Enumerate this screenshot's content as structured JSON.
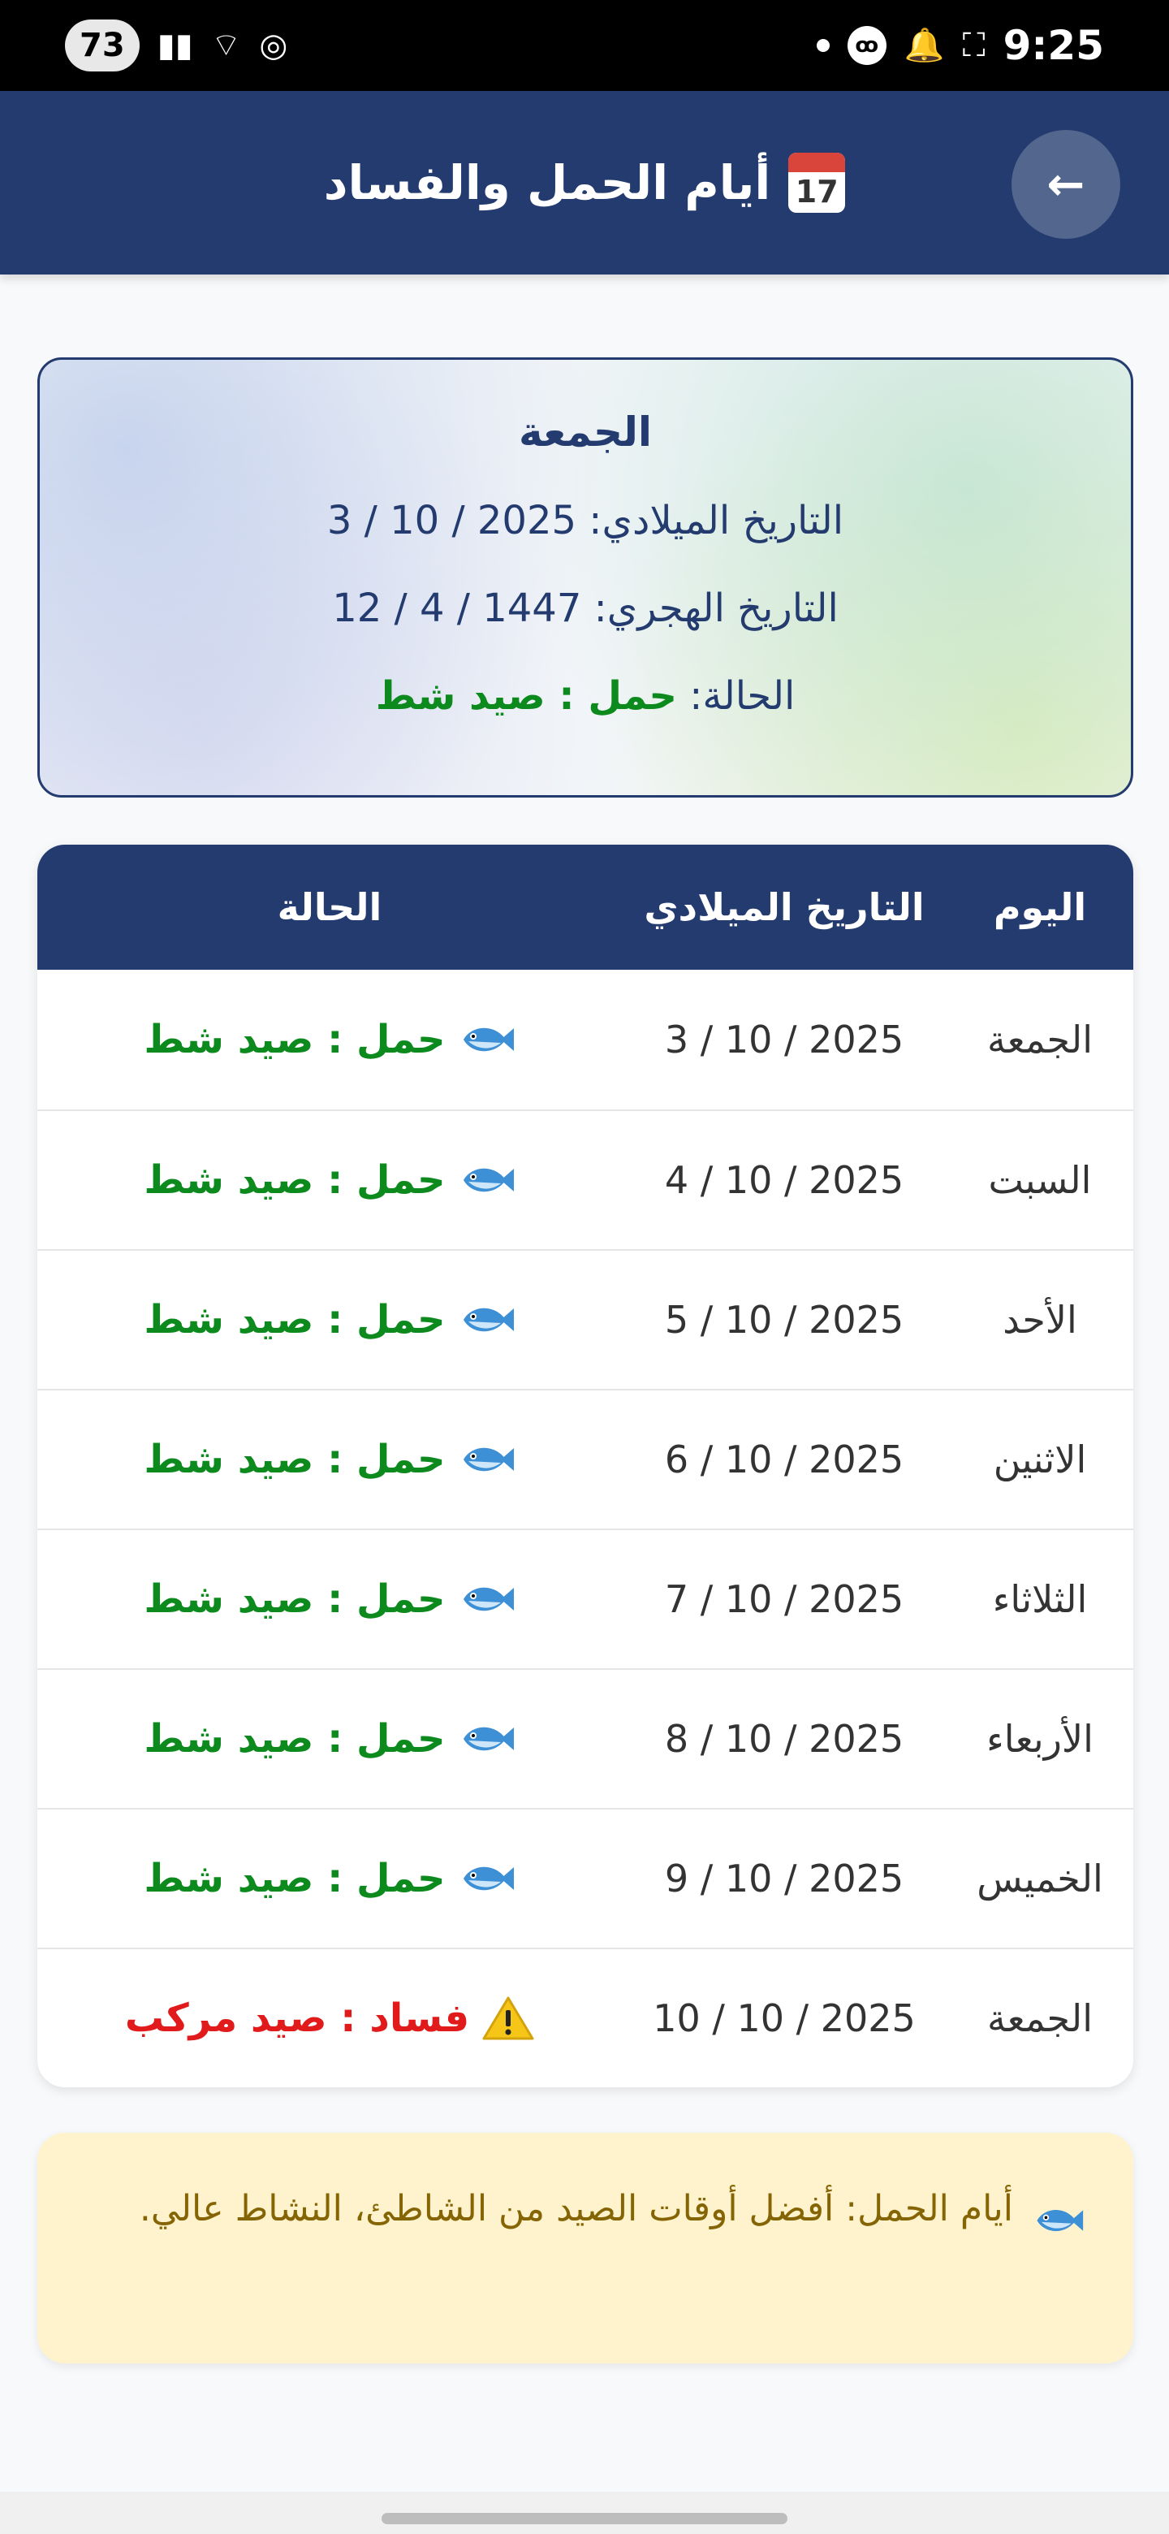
{
  "status_bar": {
    "battery": "73",
    "time": "9:25"
  },
  "app_bar": {
    "title": "أيام الحمل والفساد",
    "calendar_icon_day": "17",
    "back_arrow": "←"
  },
  "today": {
    "day": "الجمعة",
    "gregorian_label": "التاريخ الميلادي:",
    "gregorian_value": "3 / 10 / 2025",
    "hijri_label": "التاريخ الهجري:",
    "hijri_value": "12 / 4 / 1447",
    "status_label": "الحالة:",
    "status_value": "حمل : صيد شط"
  },
  "table": {
    "headers": {
      "day": "اليوم",
      "date": "التاريخ الميلادي",
      "status": "الحالة"
    },
    "rows": [
      {
        "day": "الجمعة",
        "date": "3 / 10 / 2025",
        "status": "حمل : صيد شط",
        "type": "good"
      },
      {
        "day": "السبت",
        "date": "4 / 10 / 2025",
        "status": "حمل : صيد شط",
        "type": "good"
      },
      {
        "day": "الأحد",
        "date": "5 / 10 / 2025",
        "status": "حمل : صيد شط",
        "type": "good"
      },
      {
        "day": "الاثنين",
        "date": "6 / 10 / 2025",
        "status": "حمل : صيد شط",
        "type": "good"
      },
      {
        "day": "الثلاثاء",
        "date": "7 / 10 / 2025",
        "status": "حمل : صيد شط",
        "type": "good"
      },
      {
        "day": "الأربعاء",
        "date": "8 / 10 / 2025",
        "status": "حمل : صيد شط",
        "type": "good"
      },
      {
        "day": "الخميس",
        "date": "9 / 10 / 2025",
        "status": "حمل : صيد شط",
        "type": "good"
      },
      {
        "day": "الجمعة",
        "date": "10 / 10 / 2025",
        "status": "فساد : صيد مركب",
        "type": "bad"
      }
    ]
  },
  "info": {
    "text": "أيام الحمل: أفضل أوقات الصيد من الشاطئ، النشاط عالي."
  },
  "colors": {
    "primary": "#233b6e",
    "good": "#0d8a1d",
    "bad": "#e11b1b",
    "info_bg": "#fff3cd",
    "info_text": "#856404"
  },
  "icons": {
    "good_status": "fish-icon",
    "bad_status": "warning-icon"
  }
}
